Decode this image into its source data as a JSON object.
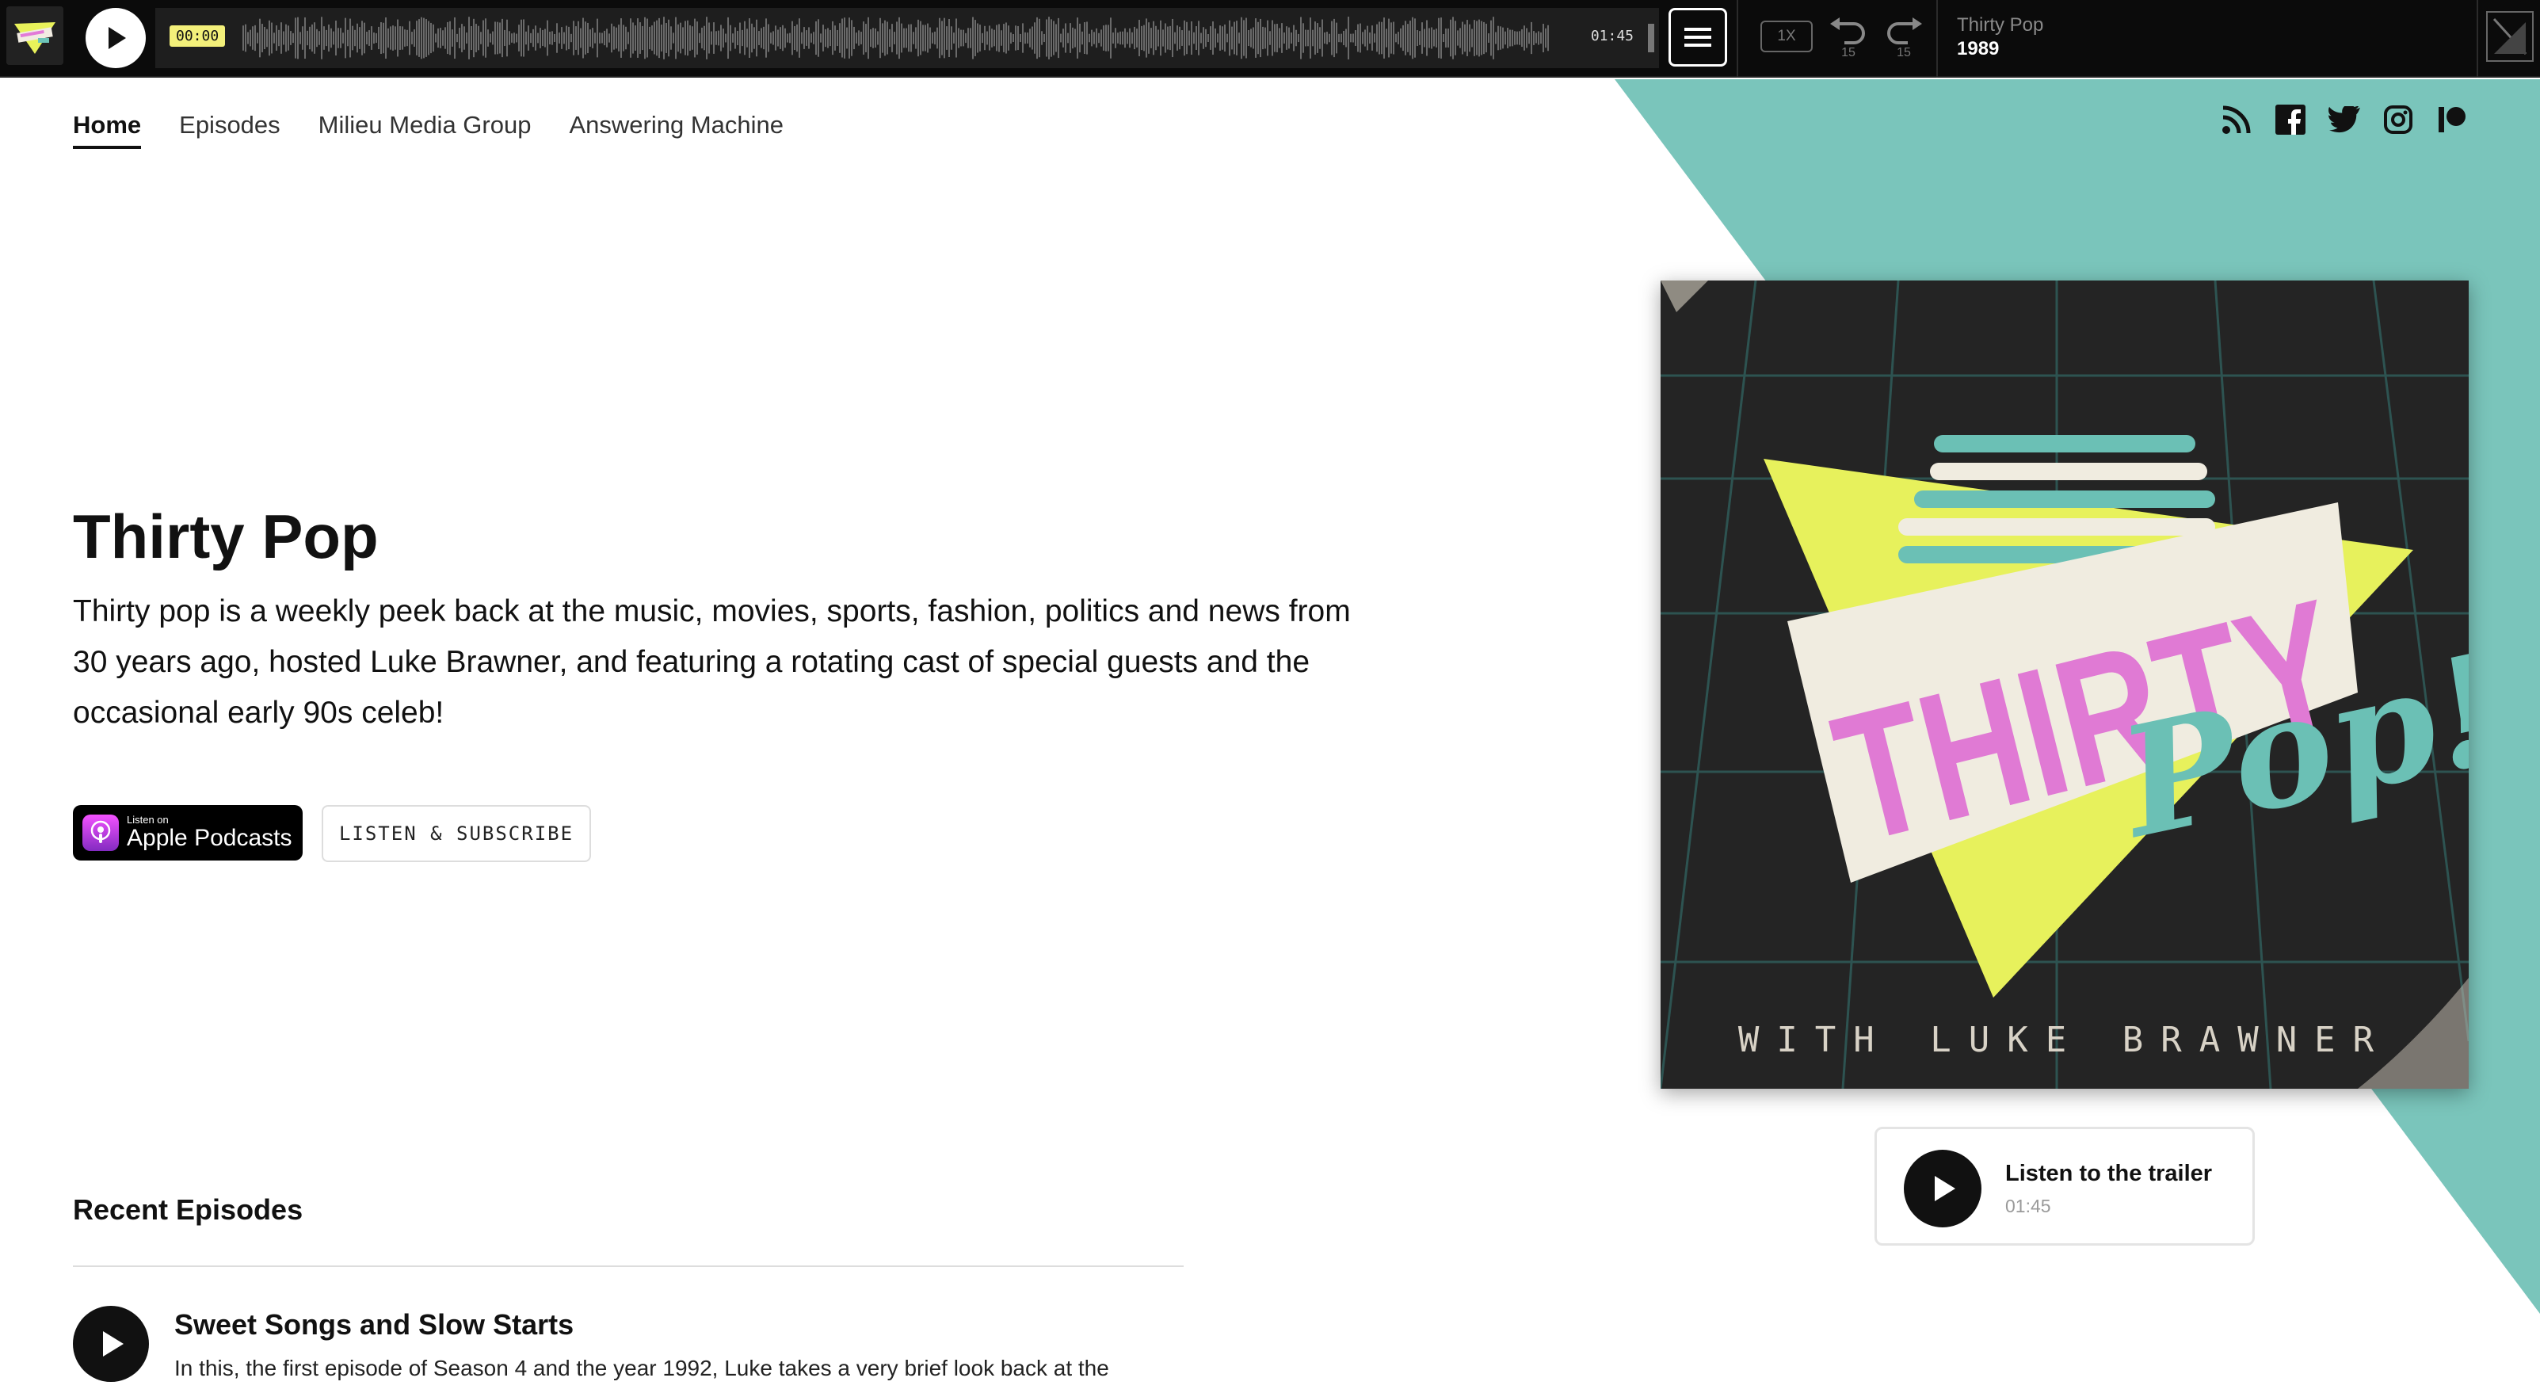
{
  "colors": {
    "accent_teal": "#7ac5bb",
    "player_bg": "#0b0b0b",
    "time_highlight": "#f3f07a"
  },
  "player": {
    "current_time": "00:00",
    "duration": "01:45",
    "speed": "1X",
    "skip_back": "15",
    "skip_forward": "15",
    "show_name": "Thirty Pop",
    "episode_title": "1989",
    "progress": 0
  },
  "nav": {
    "items": [
      {
        "label": "Home",
        "active": true
      },
      {
        "label": "Episodes"
      },
      {
        "label": "Milieu Media Group"
      },
      {
        "label": "Answering Machine"
      }
    ]
  },
  "social_icons": [
    "rss-icon",
    "facebook-icon",
    "twitter-icon",
    "instagram-icon",
    "patreon-icon"
  ],
  "hero": {
    "title": "Thirty Pop",
    "description": "Thirty pop is a weekly peek back at the music, movies, sports, fashion, politics and news from 30 years ago, hosted Luke Brawner, and featuring a rotating cast of special guests and the occasional early 90s celeb!",
    "apple_small": "Listen on",
    "apple_big": "Apple Podcasts",
    "listen_button": "LISTEN & SUBSCRIBE"
  },
  "cover": {
    "logo_word_1": "THIRTY",
    "logo_word_2": "Pop!",
    "caption": "WITH LUKE BRAWNER"
  },
  "trailer": {
    "label": "Listen to the trailer",
    "duration": "01:45"
  },
  "recent": {
    "heading": "Recent Episodes",
    "episodes": [
      {
        "title": "Sweet Songs and Slow Starts",
        "description": "In this, the first episode of Season 4 and the year 1992, Luke takes a very brief look back at the"
      }
    ]
  }
}
